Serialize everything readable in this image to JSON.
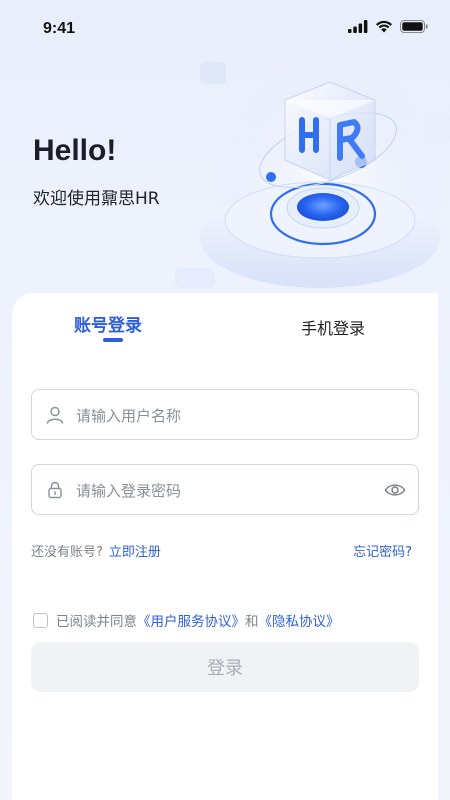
{
  "status_bar": {
    "time": "9:41",
    "icons": [
      "signal-icon",
      "wifi-icon",
      "battery-icon"
    ]
  },
  "hero": {
    "greeting": "Hello!",
    "welcome": "欢迎使用鼐思HR",
    "illustration": "3d-hr-cube-illustration"
  },
  "tabs": [
    {
      "label": "账号登录",
      "active": true
    },
    {
      "label": "手机登录",
      "active": false
    }
  ],
  "form": {
    "username": {
      "placeholder": "请输入用户名称",
      "value": "",
      "icon": "user-icon"
    },
    "password": {
      "placeholder": "请输入登录密码",
      "value": "",
      "icon": "lock-icon",
      "toggle_icon": "eye-icon"
    }
  },
  "links": {
    "no_account": "还没有账号?",
    "register": "立即注册",
    "forgot": "忘记密码?"
  },
  "agreement": {
    "checked": false,
    "prefix": "已阅读并同意",
    "service_link": "《用户服务协议》",
    "and": "和",
    "privacy_link": "《隐私协议》"
  },
  "login_button": "登录",
  "colors": {
    "accent": "#2f5fd8",
    "disabled_bg": "#f1f2f5",
    "disabled_text": "#a9adb5"
  }
}
